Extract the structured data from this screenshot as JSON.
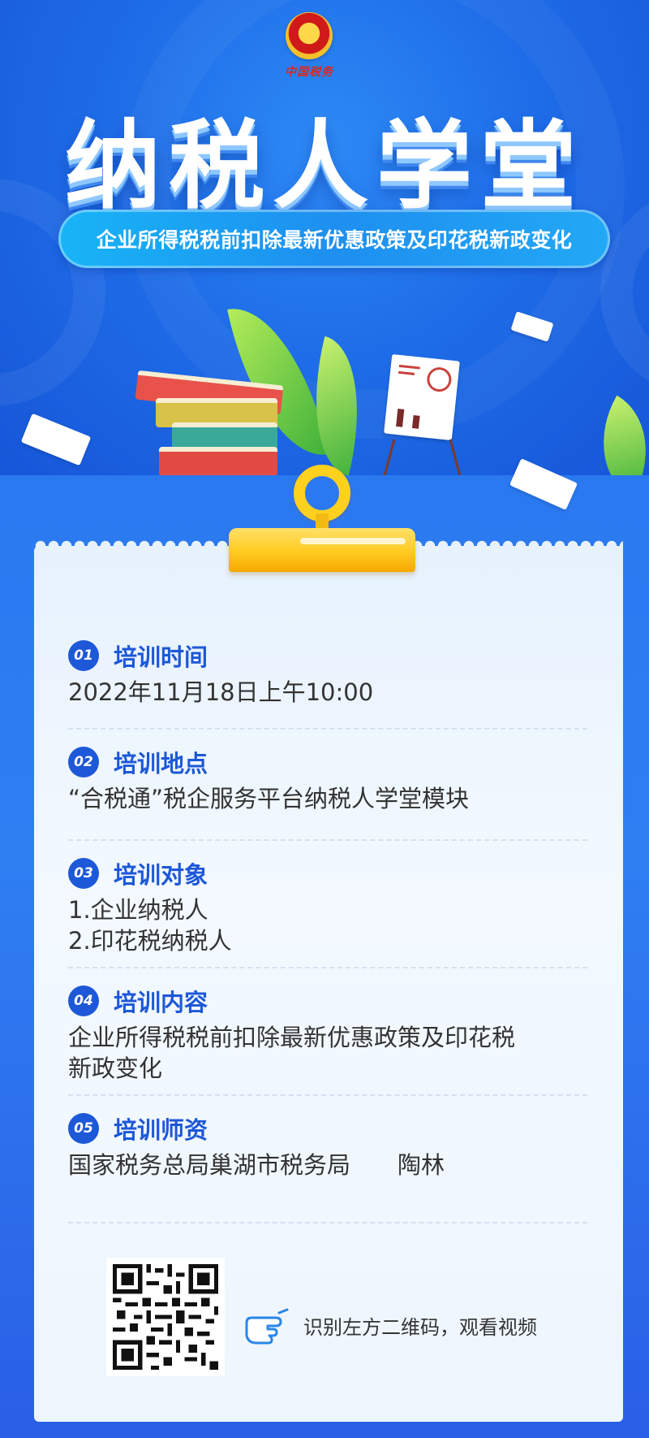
{
  "header": {
    "emblem_text": "中国税务",
    "title": "纳税人学堂",
    "subtitle": "企业所得税税前扣除最新优惠政策及印花税新政变化"
  },
  "sections": [
    {
      "num": "01",
      "title": "培训时间",
      "body": [
        "2022年11月18日上午10:00"
      ]
    },
    {
      "num": "02",
      "title": "培训地点",
      "body": [
        "“合税通”税企服务平台纳税人学堂模块"
      ]
    },
    {
      "num": "03",
      "title": "培训对象",
      "body": [
        "1.企业纳税人",
        "2.印花税纳税人"
      ]
    },
    {
      "num": "04",
      "title": "培训内容",
      "body": [
        "企业所得税税前扣除最新优惠政策及印花税",
        "新政变化"
      ]
    },
    {
      "num": "05",
      "title": "培训师资",
      "body": [
        "国家税务总局巢湖市税务局　　陶林"
      ]
    }
  ],
  "qr": {
    "tip": "识别左方二维码，观看视频"
  },
  "colors": {
    "accent": "#1d58d8",
    "background": "#1f6de8",
    "card": "#eef6fe",
    "clip": "#ffcb1f"
  },
  "icons": [
    "tax-emblem-icon",
    "books-icon",
    "plant-icon",
    "easel-chart-icon",
    "paper-icon",
    "clip-icon",
    "qr-code-icon",
    "pointing-hand-icon"
  ]
}
